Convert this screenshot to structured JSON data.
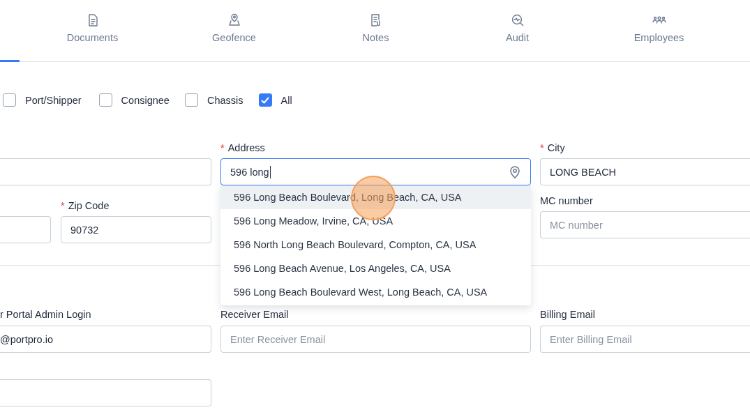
{
  "tabs": [
    {
      "label": "Documents",
      "selected": false
    },
    {
      "label": "Geofence",
      "selected": false
    },
    {
      "label": "Notes",
      "selected": false
    },
    {
      "label": "Audit",
      "selected": false
    },
    {
      "label": "Employees",
      "selected": false
    }
  ],
  "filters": [
    {
      "label": "Port/Shipper",
      "checked": false
    },
    {
      "label": "Consignee",
      "checked": false
    },
    {
      "label": "Chassis",
      "checked": false
    },
    {
      "label": "All",
      "checked": true
    }
  ],
  "address_section": {
    "address": {
      "label": "Address",
      "required_mark": "*",
      "value": "596 long",
      "focused": true
    },
    "city": {
      "label": "City",
      "required_mark": "*",
      "value": "LONG BEACH"
    },
    "zip_code": {
      "label": "Zip Code",
      "required_mark": "*",
      "value": "90732"
    },
    "mc_number": {
      "label": "MC number",
      "placeholder": "MC number"
    },
    "suggestions": [
      {
        "text": "596 Long Beach Boulevard, Long Beach, CA, USA",
        "selected": true
      },
      {
        "text": "596 Long Meadow, Irvine, CA, USA",
        "selected": false
      },
      {
        "text": "596 North Long Beach Boulevard, Compton, CA, USA",
        "selected": false
      },
      {
        "text": "596 Long Beach Avenue, Los Angeles, CA, USA",
        "selected": false
      },
      {
        "text": "596 Long Beach Boulevard West, Long Beach, CA, USA",
        "selected": false
      }
    ]
  },
  "contact_section": {
    "portal_login": {
      "label": "r Portal Admin Login",
      "value": "@portpro.io"
    },
    "receiver_email": {
      "label": "Receiver Email",
      "placeholder": "Enter Receiver Email"
    },
    "billing_email": {
      "label": "Billing Email",
      "placeholder": "Enter Billing Email"
    }
  },
  "click_highlight": true
}
